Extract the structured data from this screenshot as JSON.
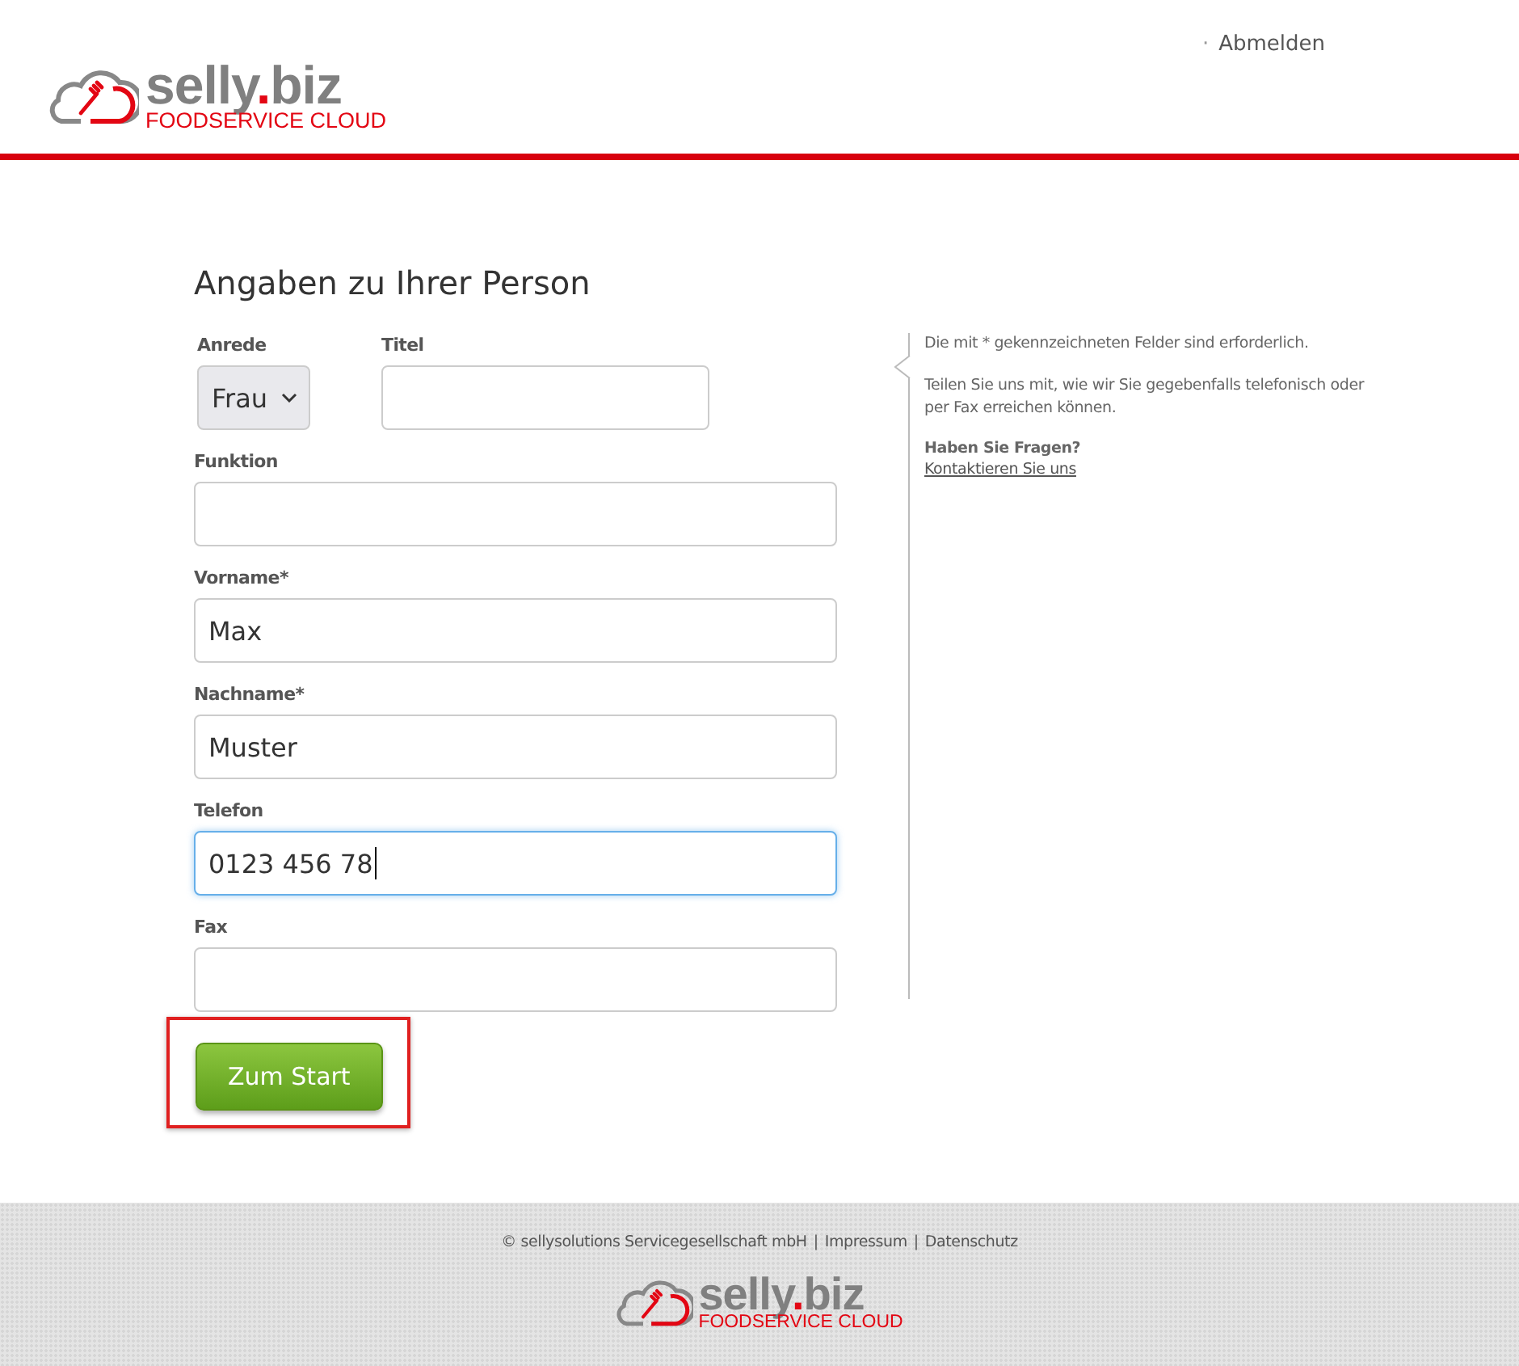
{
  "header": {
    "logo": {
      "name_start": "selly",
      "name_dot": ".",
      "name_end": "biz",
      "tagline": "FOODSERVICE CLOUD"
    },
    "nav": [
      {
        "marker": "·",
        "label": "Abmelden"
      }
    ]
  },
  "form": {
    "title": "Angaben zu Ihrer Person",
    "rows": [
      [
        {
          "kind": "select",
          "label": "Anrede",
          "value": "Frau",
          "focused": false
        },
        {
          "kind": "input",
          "label": "Titel",
          "focused": false
        }
      ],
      [
        {
          "kind": "input",
          "label": "Funktion",
          "focused": false
        }
      ],
      [
        {
          "kind": "input",
          "label": "Vorname*",
          "value": "Max",
          "focused": false
        }
      ],
      [
        {
          "kind": "input",
          "label": "Nachname*",
          "value": "Muster",
          "focused": false
        }
      ],
      [
        {
          "kind": "input",
          "label": "Telefon",
          "value": "0123 456 78",
          "focused": true
        }
      ],
      [
        {
          "kind": "input",
          "label": "Fax",
          "focused": false
        }
      ]
    ],
    "submit": {
      "label": "Zum Start",
      "highlighted": true
    }
  },
  "aside": {
    "required_note": "Die mit * gekennzeichneten Felder sind erforderlich.",
    "contact_note": "Teilen Sie uns mit, wie wir Sie gegebenfalls telefonisch oder per Fax erreichen können.",
    "question": "Haben Sie Fragen?",
    "contact_link": "Kontaktieren Sie uns"
  },
  "footer": {
    "copyright": "© sellysolutions Servicegesellschaft mbH",
    "links": [
      {
        "separator": "|",
        "label": "Impressum"
      },
      {
        "separator": "|",
        "label": "Datenschutz"
      }
    ],
    "logo": {
      "name_start": "selly",
      "name_dot": ".",
      "name_end": "biz",
      "tagline": "FOODSERVICE CLOUD"
    }
  }
}
